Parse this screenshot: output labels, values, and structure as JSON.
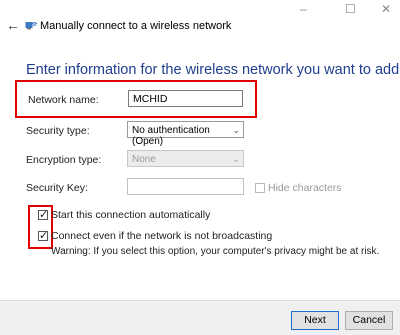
{
  "window": {
    "title": "Manually connect to a wireless network",
    "controls": {
      "minimize": "–",
      "maximize": "☐",
      "close": "✕"
    }
  },
  "nav": {
    "back_icon": "back-arrow-icon",
    "app_icon": "wireless-network-icon"
  },
  "form": {
    "heading": "Enter information for the wireless network you want to add",
    "network_name": {
      "label": "Network name:",
      "value": "MCHID"
    },
    "security_type": {
      "label": "Security type:",
      "value": "No authentication (Open)"
    },
    "encryption_type": {
      "label": "Encryption type:",
      "value": "None"
    },
    "security_key": {
      "label": "Security Key:",
      "value": ""
    },
    "hide_characters": {
      "label": "Hide characters",
      "checked": false
    },
    "start_automatically": {
      "label": "Start this connection automatically",
      "checked": true
    },
    "connect_even_if": {
      "label": "Connect even if the network is not broadcasting",
      "checked": true
    },
    "warning": "Warning: If you select this option, your computer's privacy might be at risk."
  },
  "footer": {
    "next_label": "Next",
    "cancel_label": "Cancel"
  },
  "colors": {
    "highlight": "#e00000",
    "heading": "#1f3f8c",
    "primary_border": "#1f6fd0"
  }
}
